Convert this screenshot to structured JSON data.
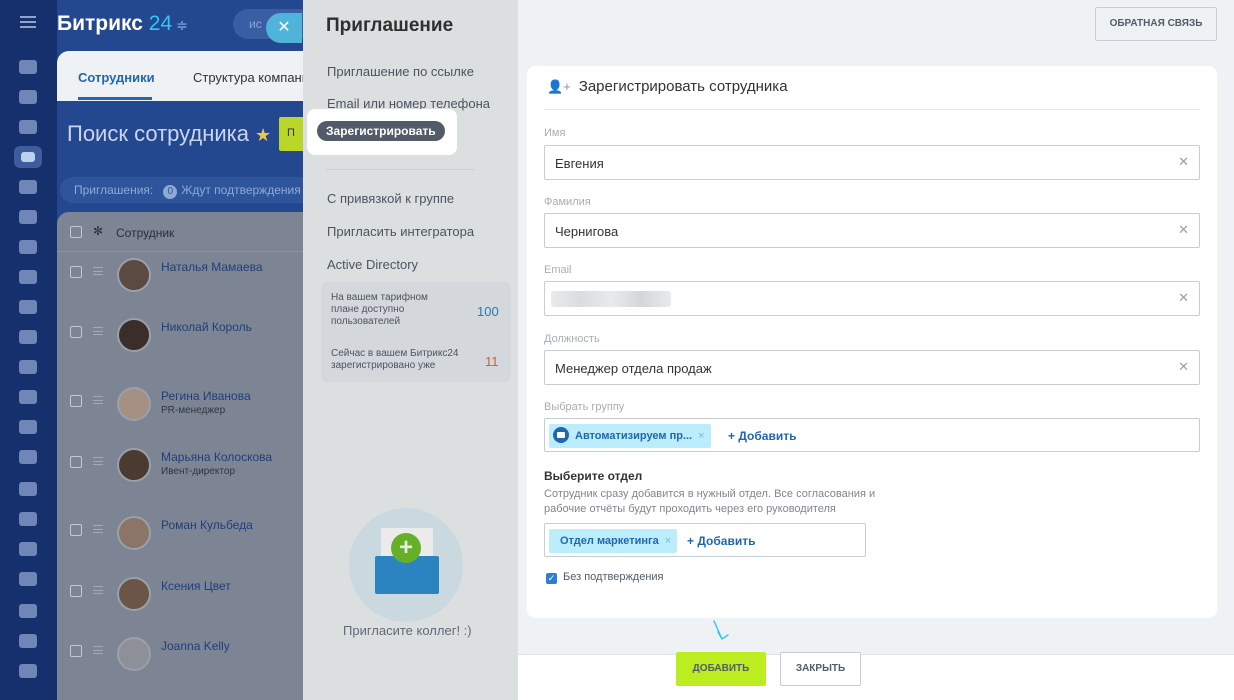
{
  "app": {
    "logo": "Битрикс",
    "logo_num": "24",
    "search_placeholder": "ис",
    "tabs": [
      "Сотрудники",
      "Структура компании"
    ],
    "page_title": "Поиск сотрудника",
    "green_button": "П",
    "invites_label": "Приглашения:",
    "invites_count": "0",
    "invites_pending": "Ждут подтверждения",
    "table_header": "Сотрудник",
    "employees": [
      {
        "name": "Наталья Мамаева",
        "position": ""
      },
      {
        "name": "Николай Король",
        "position": ""
      },
      {
        "name": "Регина Иванова",
        "position": "PR-менеджер"
      },
      {
        "name": "Марьяна Колоскова",
        "position": "Ивент-директор"
      },
      {
        "name": "Роман Кульбеда",
        "position": ""
      },
      {
        "name": "Ксения Цвет",
        "position": ""
      },
      {
        "name": "Joanna Kelly",
        "position": ""
      }
    ]
  },
  "slider": {
    "title": "Приглашение",
    "feedback_button": "ОБРАТНАЯ СВЯЗЬ",
    "menu": {
      "by_link": "Приглашение по ссылке",
      "email_phone": "Email или номер телефона",
      "register": "Зарегистрировать",
      "with_group": "С привязкой к группе",
      "integrator": "Пригласить интегратора",
      "active_directory": "Active Directory"
    },
    "info": {
      "tariff_text": "На вашем тарифном плане доступно пользователей",
      "tariff_value": "100",
      "registered_text": "Сейчас в вашем Битрикс24 зарегистрировано уже",
      "registered_value": "11"
    },
    "invite_caption": "Пригласите коллег! :)"
  },
  "form": {
    "title": "Зарегистрировать сотрудника",
    "fields": {
      "first_name": {
        "label": "Имя",
        "value": "Евгения"
      },
      "last_name": {
        "label": "Фамилия",
        "value": "Чернигова"
      },
      "email": {
        "label": "Email",
        "value": ""
      },
      "position": {
        "label": "Должность",
        "value": "Менеджер отдела продаж"
      }
    },
    "group": {
      "label": "Выбрать группу",
      "chip": "Автоматизируем пр...",
      "add": "+ Добавить"
    },
    "department": {
      "title": "Выберите отдел",
      "description": "Сотрудник сразу добавится в нужный отдел. Все согласования и рабочие отчёты будут проходить через его руководителя",
      "chip": "Отдел маркетинга",
      "add": "+ Добавить"
    },
    "no_confirmation": "Без подтверждения",
    "buttons": {
      "add": "ДОБАВИТЬ",
      "close": "ЗАКРЫТЬ"
    }
  },
  "colors": {
    "rail": "#15306d",
    "app_bg": "#23488f",
    "accent_link": "#2067b0",
    "add_button": "#bbed21",
    "chip_bg": "#bcedfc"
  },
  "icons": {
    "clear": "×",
    "check": "✓",
    "user_plus": "👤+"
  }
}
